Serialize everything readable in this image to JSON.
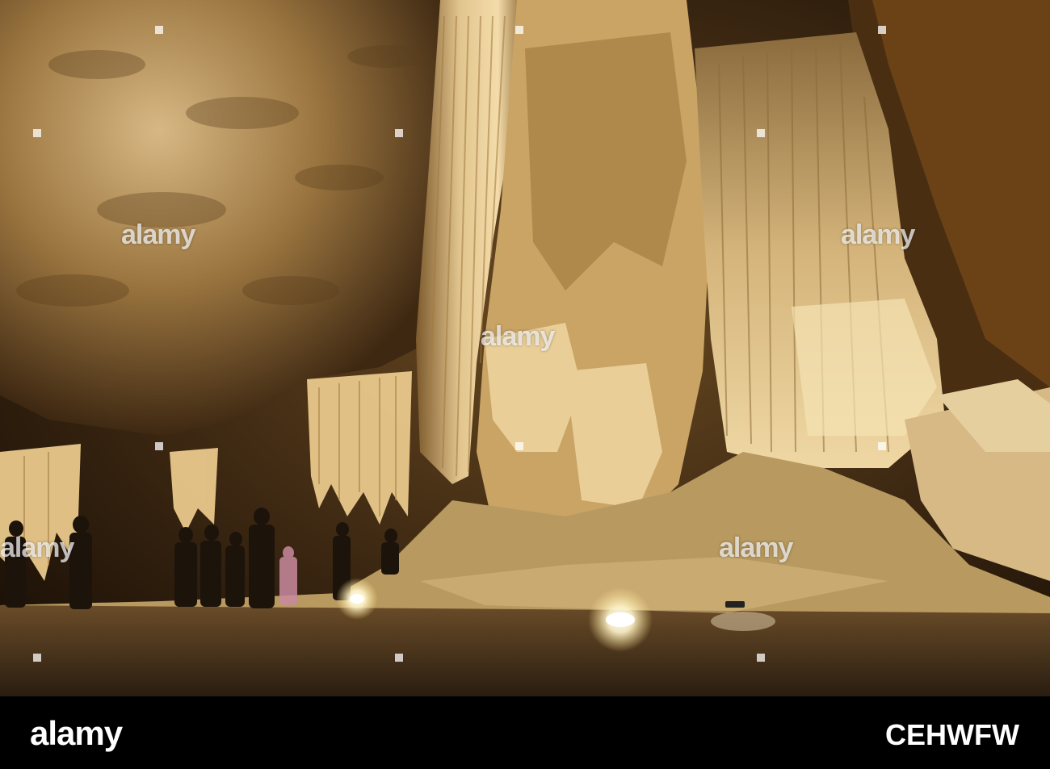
{
  "watermark": {
    "text": "alamy"
  },
  "footer": {
    "logo": "alamy",
    "image_code": "CEHWFW"
  },
  "colors": {
    "background": "#000000",
    "rock_glow": "#e8b85c",
    "rock_shadow": "#2a1a0a"
  }
}
